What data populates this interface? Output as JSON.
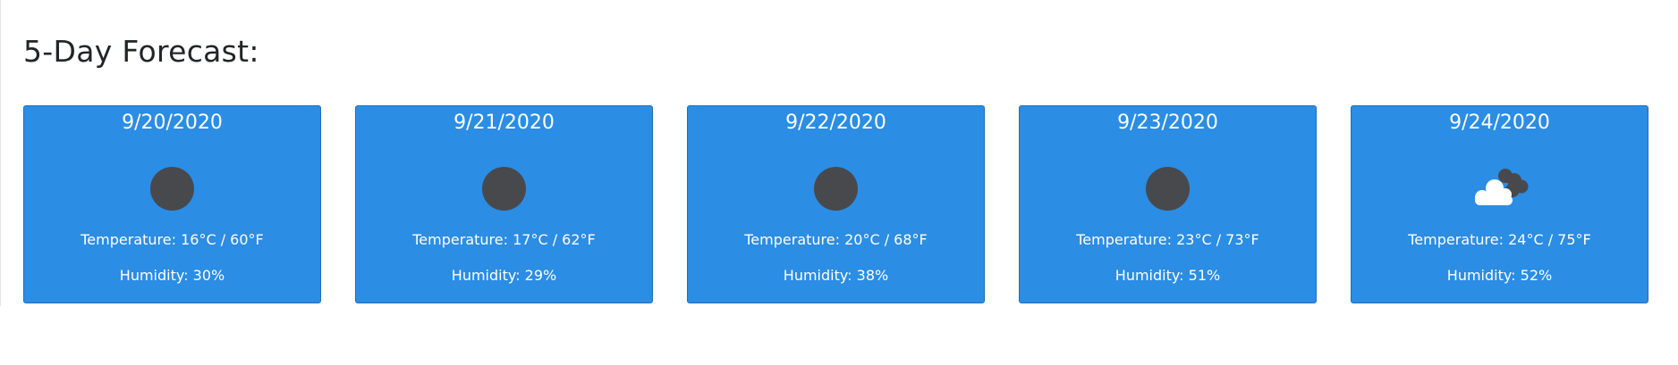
{
  "forecast": {
    "title": "5-Day Forecast:",
    "days": [
      {
        "date": "9/20/2020",
        "icon": "dark-circle-icon",
        "temperature": "Temperature: 16°C / 60°F",
        "humidity": "Humidity: 30%"
      },
      {
        "date": "9/21/2020",
        "icon": "dark-circle-icon",
        "temperature": "Temperature: 17°C / 62°F",
        "humidity": "Humidity: 29%"
      },
      {
        "date": "9/22/2020",
        "icon": "dark-circle-icon",
        "temperature": "Temperature: 20°C / 68°F",
        "humidity": "Humidity: 38%"
      },
      {
        "date": "9/23/2020",
        "icon": "dark-circle-icon",
        "temperature": "Temperature: 23°C / 73°F",
        "humidity": "Humidity: 51%"
      },
      {
        "date": "9/24/2020",
        "icon": "clouds-icon",
        "temperature": "Temperature: 24°C / 75°F",
        "humidity": "Humidity: 52%"
      }
    ]
  },
  "colors": {
    "card_background": "#2b8de4",
    "icon_dark": "#48494c",
    "heading_text": "#222426"
  }
}
